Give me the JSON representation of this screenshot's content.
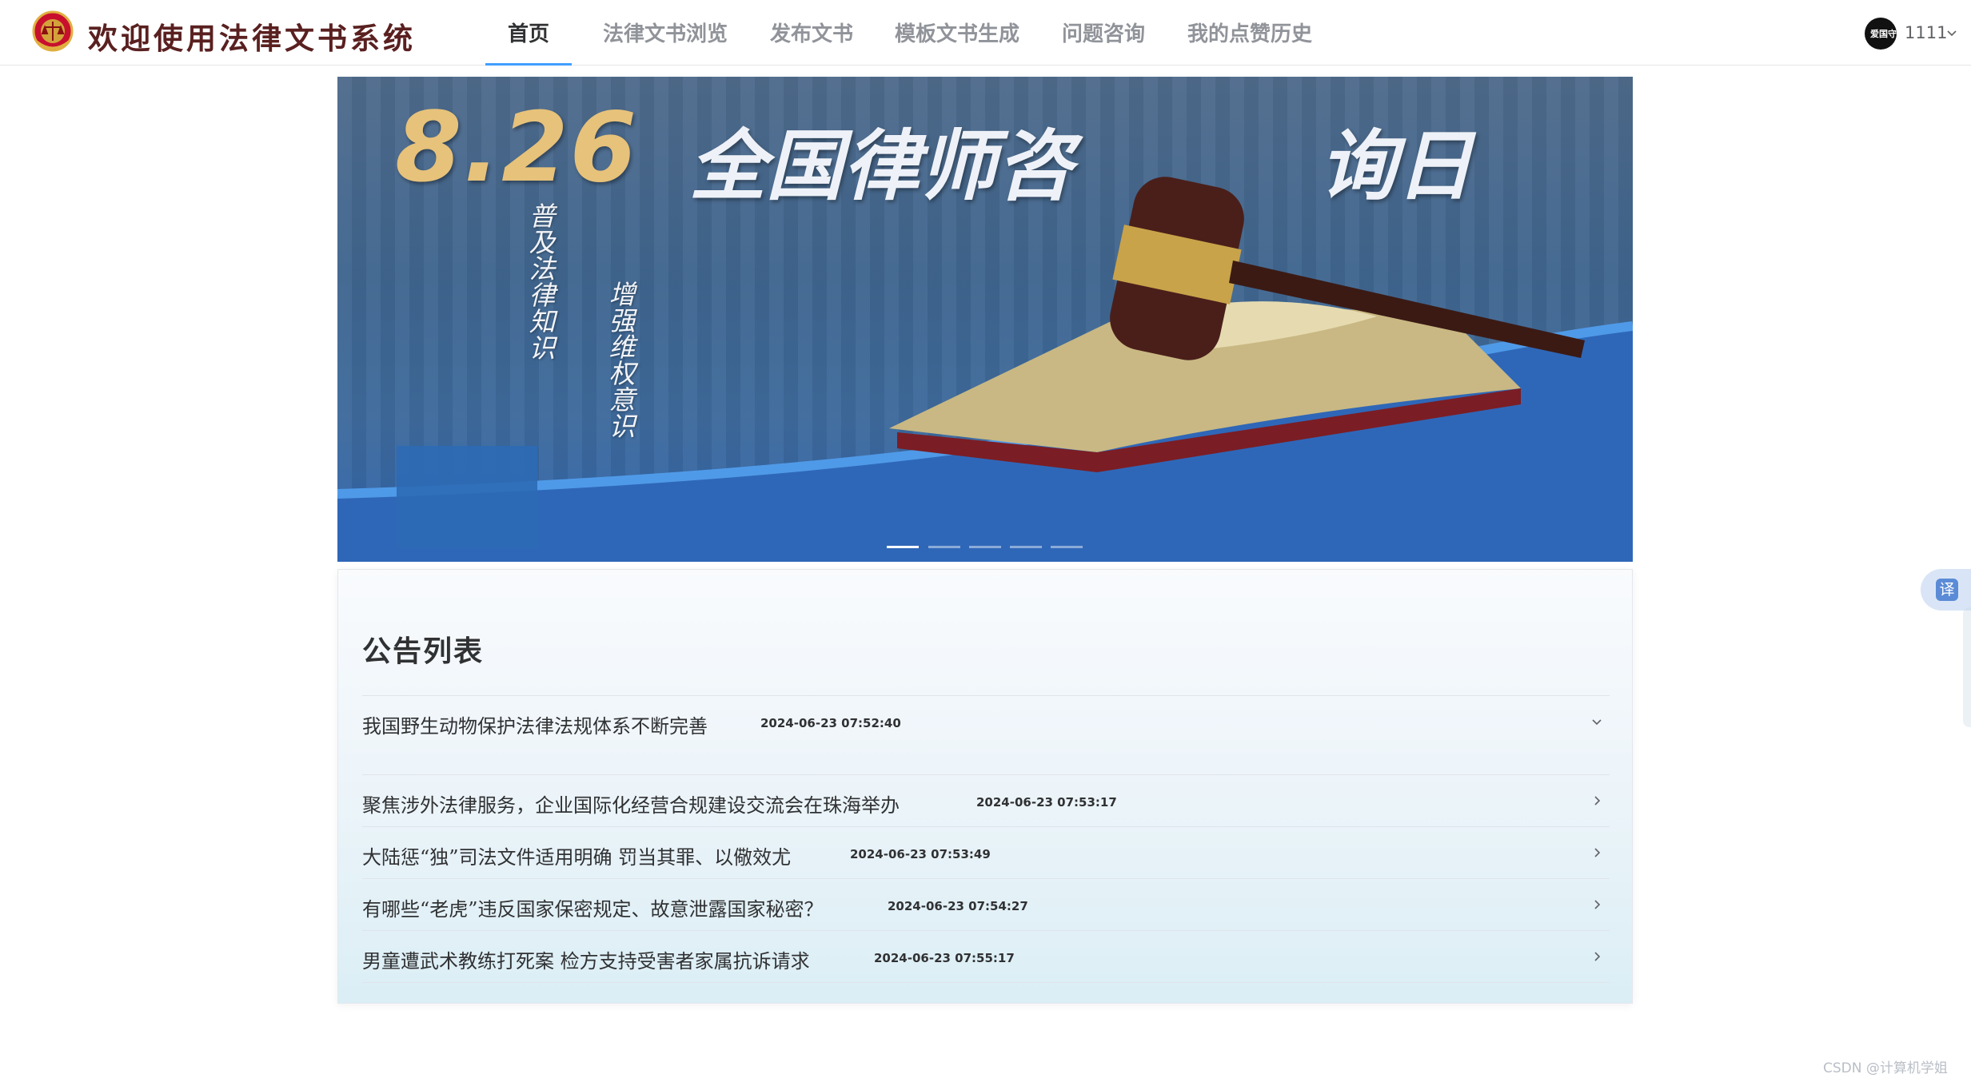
{
  "header": {
    "app_title": "欢迎使用法律文书系统",
    "nav": [
      {
        "label": "首页",
        "active": true
      },
      {
        "label": "法律文书浏览",
        "active": false
      },
      {
        "label": "发布文书",
        "active": false
      },
      {
        "label": "模板文书生成",
        "active": false
      },
      {
        "label": "问题咨询",
        "active": false
      },
      {
        "label": "我的点赞历史",
        "active": false
      }
    ],
    "user": {
      "avatar_text": "爱国守法",
      "name": "1111",
      "dropdown_icon": "chevron-down-icon"
    },
    "active_color": "#409eff"
  },
  "banner": {
    "headline_number": "8.26",
    "headline_left": "全国律师咨",
    "headline_right": "询日",
    "vertical_text_1": "普及法律知识",
    "vertical_text_2": "增强维权意识",
    "slide_count": 5,
    "active_slide": 1
  },
  "announcements": {
    "title": "公告列表",
    "items": [
      {
        "title": "我国野生动物保护法律法规体系不断完善",
        "time": "2024-06-23 07:52:40",
        "expanded": true
      },
      {
        "title": "聚焦涉外法律服务，企业国际化经营合规建设交流会在珠海举办",
        "time": "2024-06-23 07:53:17",
        "expanded": false
      },
      {
        "title": "大陆惩“独”司法文件适用明确 罚当其罪、以儆效尤",
        "time": "2024-06-23 07:53:49",
        "expanded": false
      },
      {
        "title": "有哪些“老虎”违反国家保密规定、故意泄露国家秘密？",
        "time": "2024-06-23 07:54:27",
        "expanded": false
      },
      {
        "title": "男童遭武术教练打死案 检方支持受害者家属抗诉请求",
        "time": "2024-06-23 07:55:17",
        "expanded": false
      }
    ]
  },
  "floating": {
    "translate_label": "译"
  },
  "watermark": "CSDN @计算机学姐"
}
